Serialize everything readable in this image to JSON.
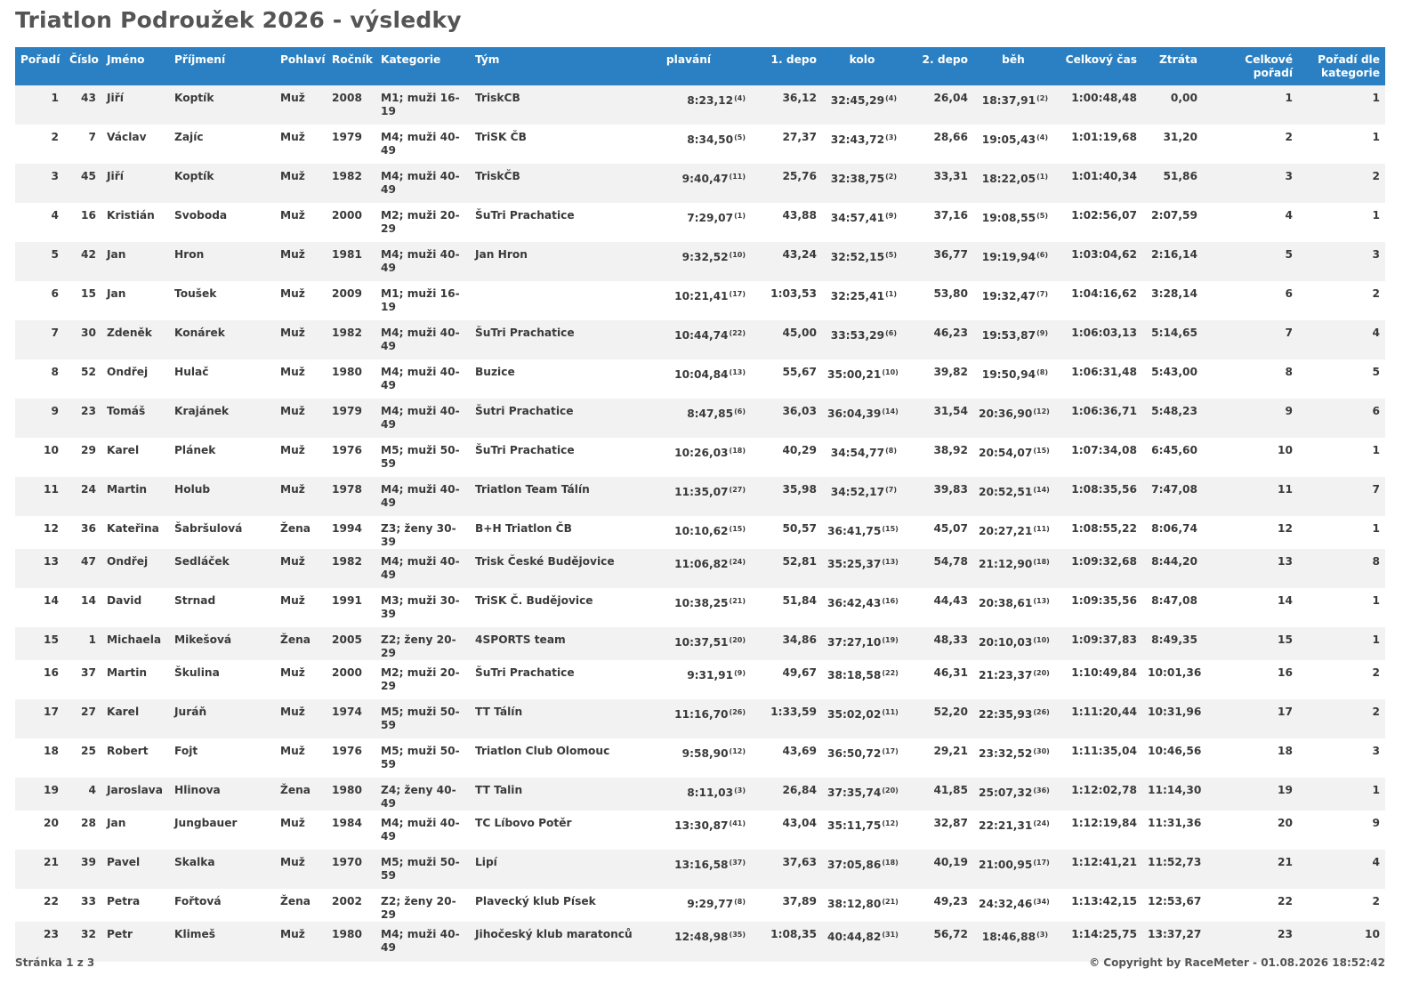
{
  "title": "Triatlon Podroužek 2026 - výsledky",
  "columns": [
    {
      "label": "Pořadí",
      "align": "c"
    },
    {
      "label": "Číslo",
      "align": "c"
    },
    {
      "label": "Jméno",
      "align": "l"
    },
    {
      "label": "Příjmení",
      "align": "l"
    },
    {
      "label": "Pohlaví",
      "align": "l"
    },
    {
      "label": "Ročník",
      "align": "l"
    },
    {
      "label": "Kategorie",
      "align": "l"
    },
    {
      "label": "Tým",
      "align": "l"
    },
    {
      "label": "plavání",
      "align": "c"
    },
    {
      "label": "1. depo",
      "align": "r"
    },
    {
      "label": "kolo",
      "align": "c"
    },
    {
      "label": "2. depo",
      "align": "r"
    },
    {
      "label": "běh",
      "align": "c"
    },
    {
      "label": "Celkový čas",
      "align": "r"
    },
    {
      "label": "Ztráta",
      "align": "r"
    },
    {
      "label": "Celkové pořadí",
      "align": "r"
    },
    {
      "label": "Pořadí dle kategorie",
      "align": "r"
    }
  ],
  "rows": [
    {
      "poradi": "1",
      "cislo": "43",
      "jmeno": "Jiří",
      "prijmeni": "Koptík",
      "pohlavi": "Muž",
      "rocnik": "2008",
      "kategorie": "M1; muži 16-19",
      "tym": "TriskCB",
      "plavani": "8:23,12",
      "plavani_rank": "(4)",
      "depo1": "36,12",
      "kolo": "32:45,29",
      "kolo_rank": "(4)",
      "depo2": "26,04",
      "beh": "18:37,91",
      "beh_rank": "(2)",
      "celkovy_cas": "1:00:48,48",
      "ztrata": "0,00",
      "celkove_poradi": "1",
      "poradi_kategorie": "1"
    },
    {
      "poradi": "2",
      "cislo": "7",
      "jmeno": "Václav",
      "prijmeni": "Zajíc",
      "pohlavi": "Muž",
      "rocnik": "1979",
      "kategorie": "M4; muži 40-49",
      "tym": "TriSK ČB",
      "plavani": "8:34,50",
      "plavani_rank": "(5)",
      "depo1": "27,37",
      "kolo": "32:43,72",
      "kolo_rank": "(3)",
      "depo2": "28,66",
      "beh": "19:05,43",
      "beh_rank": "(4)",
      "celkovy_cas": "1:01:19,68",
      "ztrata": "31,20",
      "celkove_poradi": "2",
      "poradi_kategorie": "1"
    },
    {
      "poradi": "3",
      "cislo": "45",
      "jmeno": "Jiří",
      "prijmeni": "Koptík",
      "pohlavi": "Muž",
      "rocnik": "1982",
      "kategorie": "M4; muži 40-49",
      "tym": "TriskČB",
      "plavani": "9:40,47",
      "plavani_rank": "(11)",
      "depo1": "25,76",
      "kolo": "32:38,75",
      "kolo_rank": "(2)",
      "depo2": "33,31",
      "beh": "18:22,05",
      "beh_rank": "(1)",
      "celkovy_cas": "1:01:40,34",
      "ztrata": "51,86",
      "celkove_poradi": "3",
      "poradi_kategorie": "2"
    },
    {
      "poradi": "4",
      "cislo": "16",
      "jmeno": "Kristián",
      "prijmeni": "Svoboda",
      "pohlavi": "Muž",
      "rocnik": "2000",
      "kategorie": "M2; muži 20-29",
      "tym": "ŠuTri Prachatice",
      "plavani": "7:29,07",
      "plavani_rank": "(1)",
      "depo1": "43,88",
      "kolo": "34:57,41",
      "kolo_rank": "(9)",
      "depo2": "37,16",
      "beh": "19:08,55",
      "beh_rank": "(5)",
      "celkovy_cas": "1:02:56,07",
      "ztrata": "2:07,59",
      "celkove_poradi": "4",
      "poradi_kategorie": "1"
    },
    {
      "poradi": "5",
      "cislo": "42",
      "jmeno": "Jan",
      "prijmeni": "Hron",
      "pohlavi": "Muž",
      "rocnik": "1981",
      "kategorie": "M4; muži 40-49",
      "tym": "Jan Hron",
      "plavani": "9:32,52",
      "plavani_rank": "(10)",
      "depo1": "43,24",
      "kolo": "32:52,15",
      "kolo_rank": "(5)",
      "depo2": "36,77",
      "beh": "19:19,94",
      "beh_rank": "(6)",
      "celkovy_cas": "1:03:04,62",
      "ztrata": "2:16,14",
      "celkove_poradi": "5",
      "poradi_kategorie": "3"
    },
    {
      "poradi": "6",
      "cislo": "15",
      "jmeno": "Jan",
      "prijmeni": "Toušek",
      "pohlavi": "Muž",
      "rocnik": "2009",
      "kategorie": "M1; muži 16-19",
      "tym": "",
      "plavani": "10:21,41",
      "plavani_rank": "(17)",
      "depo1": "1:03,53",
      "kolo": "32:25,41",
      "kolo_rank": "(1)",
      "depo2": "53,80",
      "beh": "19:32,47",
      "beh_rank": "(7)",
      "celkovy_cas": "1:04:16,62",
      "ztrata": "3:28,14",
      "celkove_poradi": "6",
      "poradi_kategorie": "2"
    },
    {
      "poradi": "7",
      "cislo": "30",
      "jmeno": "Zdeněk",
      "prijmeni": "Konárek",
      "pohlavi": "Muž",
      "rocnik": "1982",
      "kategorie": "M4; muži 40-49",
      "tym": "ŠuTri Prachatice",
      "plavani": "10:44,74",
      "plavani_rank": "(22)",
      "depo1": "45,00",
      "kolo": "33:53,29",
      "kolo_rank": "(6)",
      "depo2": "46,23",
      "beh": "19:53,87",
      "beh_rank": "(9)",
      "celkovy_cas": "1:06:03,13",
      "ztrata": "5:14,65",
      "celkove_poradi": "7",
      "poradi_kategorie": "4"
    },
    {
      "poradi": "8",
      "cislo": "52",
      "jmeno": "Ondřej",
      "prijmeni": "Hulač",
      "pohlavi": "Muž",
      "rocnik": "1980",
      "kategorie": "M4; muži 40-49",
      "tym": "Buzice",
      "plavani": "10:04,84",
      "plavani_rank": "(13)",
      "depo1": "55,67",
      "kolo": "35:00,21",
      "kolo_rank": "(10)",
      "depo2": "39,82",
      "beh": "19:50,94",
      "beh_rank": "(8)",
      "celkovy_cas": "1:06:31,48",
      "ztrata": "5:43,00",
      "celkove_poradi": "8",
      "poradi_kategorie": "5"
    },
    {
      "poradi": "9",
      "cislo": "23",
      "jmeno": "Tomáš",
      "prijmeni": "Krajánek",
      "pohlavi": "Muž",
      "rocnik": "1979",
      "kategorie": "M4; muži 40-49",
      "tym": "Šutri Prachatice",
      "plavani": "8:47,85",
      "plavani_rank": "(6)",
      "depo1": "36,03",
      "kolo": "36:04,39",
      "kolo_rank": "(14)",
      "depo2": "31,54",
      "beh": "20:36,90",
      "beh_rank": "(12)",
      "celkovy_cas": "1:06:36,71",
      "ztrata": "5:48,23",
      "celkove_poradi": "9",
      "poradi_kategorie": "6"
    },
    {
      "poradi": "10",
      "cislo": "29",
      "jmeno": "Karel",
      "prijmeni": "Plánek",
      "pohlavi": "Muž",
      "rocnik": "1976",
      "kategorie": "M5; muži 50-59",
      "tym": "ŠuTri Prachatice",
      "plavani": "10:26,03",
      "plavani_rank": "(18)",
      "depo1": "40,29",
      "kolo": "34:54,77",
      "kolo_rank": "(8)",
      "depo2": "38,92",
      "beh": "20:54,07",
      "beh_rank": "(15)",
      "celkovy_cas": "1:07:34,08",
      "ztrata": "6:45,60",
      "celkove_poradi": "10",
      "poradi_kategorie": "1"
    },
    {
      "poradi": "11",
      "cislo": "24",
      "jmeno": "Martin",
      "prijmeni": "Holub",
      "pohlavi": "Muž",
      "rocnik": "1978",
      "kategorie": "M4; muži 40-49",
      "tym": "Triatlon Team Tálín",
      "plavani": "11:35,07",
      "plavani_rank": "(27)",
      "depo1": "35,98",
      "kolo": "34:52,17",
      "kolo_rank": "(7)",
      "depo2": "39,83",
      "beh": "20:52,51",
      "beh_rank": "(14)",
      "celkovy_cas": "1:08:35,56",
      "ztrata": "7:47,08",
      "celkove_poradi": "11",
      "poradi_kategorie": "7"
    },
    {
      "poradi": "12",
      "cislo": "36",
      "jmeno": "Kateřina",
      "prijmeni": "Šabršulová",
      "pohlavi": "Žena",
      "rocnik": "1994",
      "kategorie": "Z3; ženy 30-39",
      "tym": "B+H Triatlon ČB",
      "plavani": "10:10,62",
      "plavani_rank": "(15)",
      "depo1": "50,57",
      "kolo": "36:41,75",
      "kolo_rank": "(15)",
      "depo2": "45,07",
      "beh": "20:27,21",
      "beh_rank": "(11)",
      "celkovy_cas": "1:08:55,22",
      "ztrata": "8:06,74",
      "celkove_poradi": "12",
      "poradi_kategorie": "1"
    },
    {
      "poradi": "13",
      "cislo": "47",
      "jmeno": "Ondřej",
      "prijmeni": "Sedláček",
      "pohlavi": "Muž",
      "rocnik": "1982",
      "kategorie": "M4; muži 40-49",
      "tym": "Trisk České Budějovice",
      "plavani": "11:06,82",
      "plavani_rank": "(24)",
      "depo1": "52,81",
      "kolo": "35:25,37",
      "kolo_rank": "(13)",
      "depo2": "54,78",
      "beh": "21:12,90",
      "beh_rank": "(18)",
      "celkovy_cas": "1:09:32,68",
      "ztrata": "8:44,20",
      "celkove_poradi": "13",
      "poradi_kategorie": "8"
    },
    {
      "poradi": "14",
      "cislo": "14",
      "jmeno": "David",
      "prijmeni": "Strnad",
      "pohlavi": "Muž",
      "rocnik": "1991",
      "kategorie": "M3; muži 30-39",
      "tym": "TriSK Č. Budějovice",
      "plavani": "10:38,25",
      "plavani_rank": "(21)",
      "depo1": "51,84",
      "kolo": "36:42,43",
      "kolo_rank": "(16)",
      "depo2": "44,43",
      "beh": "20:38,61",
      "beh_rank": "(13)",
      "celkovy_cas": "1:09:35,56",
      "ztrata": "8:47,08",
      "celkove_poradi": "14",
      "poradi_kategorie": "1"
    },
    {
      "poradi": "15",
      "cislo": "1",
      "jmeno": "Michaela",
      "prijmeni": "Mikešová",
      "pohlavi": "Žena",
      "rocnik": "2005",
      "kategorie": "Z2; ženy 20-29",
      "tym": "4SPORTS team",
      "plavani": "10:37,51",
      "plavani_rank": "(20)",
      "depo1": "34,86",
      "kolo": "37:27,10",
      "kolo_rank": "(19)",
      "depo2": "48,33",
      "beh": "20:10,03",
      "beh_rank": "(10)",
      "celkovy_cas": "1:09:37,83",
      "ztrata": "8:49,35",
      "celkove_poradi": "15",
      "poradi_kategorie": "1"
    },
    {
      "poradi": "16",
      "cislo": "37",
      "jmeno": "Martin",
      "prijmeni": "Škulina",
      "pohlavi": "Muž",
      "rocnik": "2000",
      "kategorie": "M2; muži 20-29",
      "tym": "ŠuTri Prachatice",
      "plavani": "9:31,91",
      "plavani_rank": "(9)",
      "depo1": "49,67",
      "kolo": "38:18,58",
      "kolo_rank": "(22)",
      "depo2": "46,31",
      "beh": "21:23,37",
      "beh_rank": "(20)",
      "celkovy_cas": "1:10:49,84",
      "ztrata": "10:01,36",
      "celkove_poradi": "16",
      "poradi_kategorie": "2"
    },
    {
      "poradi": "17",
      "cislo": "27",
      "jmeno": "Karel",
      "prijmeni": "Juráň",
      "pohlavi": "Muž",
      "rocnik": "1974",
      "kategorie": "M5; muži 50-59",
      "tym": "TT Tálín",
      "plavani": "11:16,70",
      "plavani_rank": "(26)",
      "depo1": "1:33,59",
      "kolo": "35:02,02",
      "kolo_rank": "(11)",
      "depo2": "52,20",
      "beh": "22:35,93",
      "beh_rank": "(26)",
      "celkovy_cas": "1:11:20,44",
      "ztrata": "10:31,96",
      "celkove_poradi": "17",
      "poradi_kategorie": "2"
    },
    {
      "poradi": "18",
      "cislo": "25",
      "jmeno": "Robert",
      "prijmeni": "Fojt",
      "pohlavi": "Muž",
      "rocnik": "1976",
      "kategorie": "M5; muži 50-59",
      "tym": "Triatlon Club Olomouc",
      "plavani": "9:58,90",
      "plavani_rank": "(12)",
      "depo1": "43,69",
      "kolo": "36:50,72",
      "kolo_rank": "(17)",
      "depo2": "29,21",
      "beh": "23:32,52",
      "beh_rank": "(30)",
      "celkovy_cas": "1:11:35,04",
      "ztrata": "10:46,56",
      "celkove_poradi": "18",
      "poradi_kategorie": "3"
    },
    {
      "poradi": "19",
      "cislo": "4",
      "jmeno": "Jaroslava",
      "prijmeni": "Hlinova",
      "pohlavi": "Žena",
      "rocnik": "1980",
      "kategorie": "Z4; ženy 40-49",
      "tym": "TT Talin",
      "plavani": "8:11,03",
      "plavani_rank": "(3)",
      "depo1": "26,84",
      "kolo": "37:35,74",
      "kolo_rank": "(20)",
      "depo2": "41,85",
      "beh": "25:07,32",
      "beh_rank": "(36)",
      "celkovy_cas": "1:12:02,78",
      "ztrata": "11:14,30",
      "celkove_poradi": "19",
      "poradi_kategorie": "1"
    },
    {
      "poradi": "20",
      "cislo": "28",
      "jmeno": "Jan",
      "prijmeni": "Jungbauer",
      "pohlavi": "Muž",
      "rocnik": "1984",
      "kategorie": "M4; muži 40-49",
      "tym": "TC Líbovo Potěr",
      "plavani": "13:30,87",
      "plavani_rank": "(41)",
      "depo1": "43,04",
      "kolo": "35:11,75",
      "kolo_rank": "(12)",
      "depo2": "32,87",
      "beh": "22:21,31",
      "beh_rank": "(24)",
      "celkovy_cas": "1:12:19,84",
      "ztrata": "11:31,36",
      "celkove_poradi": "20",
      "poradi_kategorie": "9"
    },
    {
      "poradi": "21",
      "cislo": "39",
      "jmeno": "Pavel",
      "prijmeni": "Skalka",
      "pohlavi": "Muž",
      "rocnik": "1970",
      "kategorie": "M5; muži 50-59",
      "tym": "Lipí",
      "plavani": "13:16,58",
      "plavani_rank": "(37)",
      "depo1": "37,63",
      "kolo": "37:05,86",
      "kolo_rank": "(18)",
      "depo2": "40,19",
      "beh": "21:00,95",
      "beh_rank": "(17)",
      "celkovy_cas": "1:12:41,21",
      "ztrata": "11:52,73",
      "celkove_poradi": "21",
      "poradi_kategorie": "4"
    },
    {
      "poradi": "22",
      "cislo": "33",
      "jmeno": "Petra",
      "prijmeni": "Fořtová",
      "pohlavi": "Žena",
      "rocnik": "2002",
      "kategorie": "Z2; ženy 20-29",
      "tym": "Plavecký klub Písek",
      "plavani": "9:29,77",
      "plavani_rank": "(8)",
      "depo1": "37,89",
      "kolo": "38:12,80",
      "kolo_rank": "(21)",
      "depo2": "49,23",
      "beh": "24:32,46",
      "beh_rank": "(34)",
      "celkovy_cas": "1:13:42,15",
      "ztrata": "12:53,67",
      "celkove_poradi": "22",
      "poradi_kategorie": "2"
    },
    {
      "poradi": "23",
      "cislo": "32",
      "jmeno": "Petr",
      "prijmeni": "Klimeš",
      "pohlavi": "Muž",
      "rocnik": "1980",
      "kategorie": "M4; muži 40-49",
      "tym": "Jihočeský klub maratonců",
      "plavani": "12:48,98",
      "plavani_rank": "(35)",
      "depo1": "1:08,35",
      "kolo": "40:44,82",
      "kolo_rank": "(31)",
      "depo2": "56,72",
      "beh": "18:46,88",
      "beh_rank": "(3)",
      "celkovy_cas": "1:14:25,75",
      "ztrata": "13:37,27",
      "celkove_poradi": "23",
      "poradi_kategorie": "10"
    }
  ],
  "footer": {
    "page": "Stránka 1 z 3",
    "copyright": "© Copyright by RaceMeter - 01.08.2026 18:52:42"
  }
}
